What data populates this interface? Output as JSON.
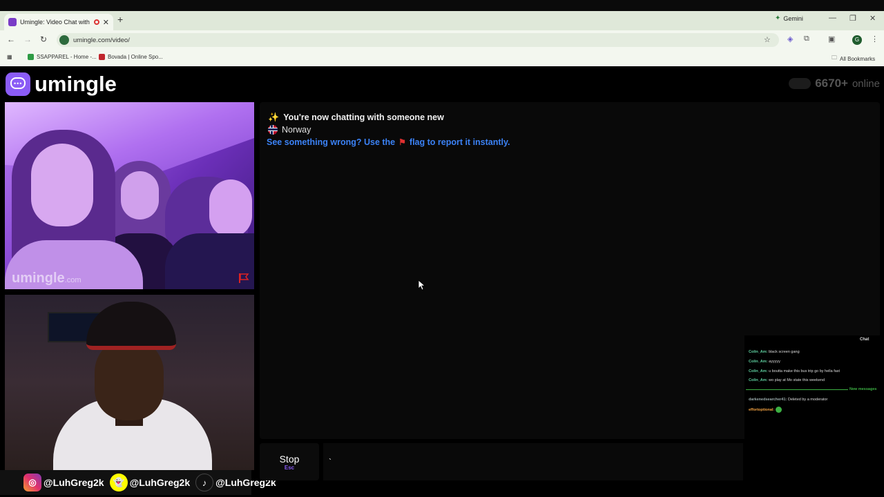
{
  "browser": {
    "tab_title": "Umingle: Video Chat with St",
    "tab_close": "✕",
    "new_tab": "+",
    "gemini_label": "Gemini",
    "url": "umingle.com/video/",
    "bookmarks": [
      {
        "label": "SSAPPAREL - Home -...",
        "color": "#2e9b45"
      },
      {
        "label": "Bovada | Online Spo...",
        "color": "#c0262d"
      }
    ],
    "all_bookmarks": "All Bookmarks",
    "profile_initial": "G",
    "icons": [
      "back-icon",
      "forward-icon",
      "reload-icon",
      "bookmark-star-icon",
      "extensions-icon",
      "profile-icon"
    ]
  },
  "app": {
    "logo_text": "umingle",
    "online_count": "6670+",
    "online_label": "online",
    "accent_color": "#8b5cf6"
  },
  "video": {
    "watermark_main": "umingle",
    "watermark_domain": ".com"
  },
  "chat": {
    "status_line": "You're now chatting with someone new",
    "country": "Norway",
    "report_prefix": "See something wrong? Use the",
    "report_suffix": "flag to report it instantly."
  },
  "socials": [
    {
      "network": "instagram",
      "handle": "@LuhGreg2k"
    },
    {
      "network": "snapchat",
      "handle": "@LuhGreg2k"
    },
    {
      "network": "tiktok",
      "handle": "@LuhGreg2k"
    }
  ],
  "stream_chat": {
    "title": "Chat",
    "messages": [
      {
        "user": "Colin_Am:",
        "text": "black screen gang"
      },
      {
        "user": "Colin_Am:",
        "text": "ayyyyy"
      },
      {
        "user": "Colin_Am:",
        "text": "u boutta make this bus trip go by hella fast"
      },
      {
        "user": "Colin_Am:",
        "text": "wo play at Mo state this weekend"
      }
    ],
    "new_messages_label": "New messages",
    "after_messages": [
      {
        "user": "darkenedsearcher41:",
        "text": "Deleted by a moderator"
      },
      {
        "user": "effortoptional:",
        "text": ""
      }
    ]
  },
  "controls": {
    "stop_label": "Stop",
    "stop_key": "Esc",
    "input_value": "`"
  }
}
